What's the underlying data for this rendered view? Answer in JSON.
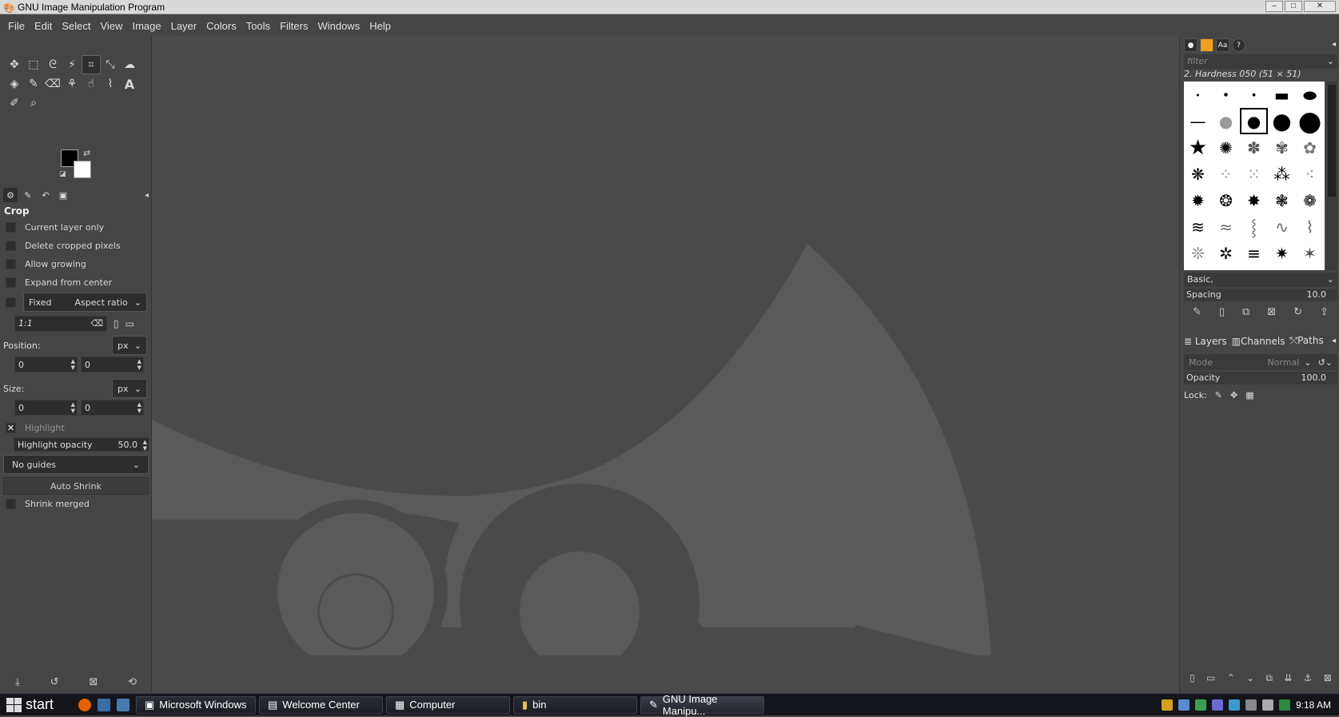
{
  "window": {
    "title": "GNU Image Manipulation Program"
  },
  "menu": [
    "File",
    "Edit",
    "Select",
    "View",
    "Image",
    "Layer",
    "Colors",
    "Tools",
    "Filters",
    "Windows",
    "Help"
  ],
  "tool_options": {
    "title": "Crop",
    "current_layer_only": "Current layer only",
    "delete_cropped": "Delete cropped pixels",
    "allow_growing": "Allow growing",
    "expand_center": "Expand from center",
    "fixed_label": "Fixed",
    "fixed_mode": "Aspect ratio",
    "ratio_value": "1:1",
    "position_label": "Position:",
    "position_unit": "px",
    "pos_x": "0",
    "pos_y": "0",
    "size_label": "Size:",
    "size_unit": "px",
    "size_w": "0",
    "size_h": "0",
    "highlight": "Highlight",
    "highlight_opacity_label": "Highlight opacity",
    "highlight_opacity_value": "50.0",
    "guides": "No guides",
    "auto_shrink": "Auto Shrink",
    "shrink_merged": "Shrink merged"
  },
  "brushes": {
    "filter_placeholder": "filter",
    "current": "2. Hardness 050 (51 × 51)",
    "tag": "Basic,",
    "spacing_label": "Spacing",
    "spacing_value": "10.0"
  },
  "layers": {
    "tabs": [
      "Layers",
      "Channels",
      "Paths"
    ],
    "mode_label": "Mode",
    "mode_value": "Normal",
    "opacity_label": "Opacity",
    "opacity_value": "100.0",
    "lock_label": "Lock:"
  },
  "taskbar": {
    "start": "start",
    "tasks": [
      "Microsoft Windows",
      "Welcome Center",
      "Computer",
      "bin",
      "GNU Image Manipu..."
    ],
    "clock": "9:18 AM"
  },
  "colors": {
    "background": "#454545",
    "canvas": "#4a4a4a",
    "wilber": "#5a5a5a"
  }
}
